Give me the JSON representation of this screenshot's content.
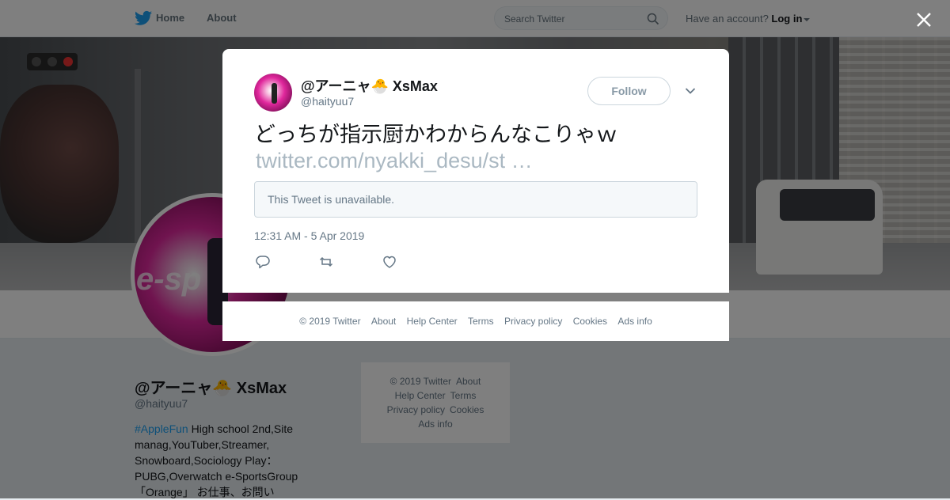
{
  "nav": {
    "home": "Home",
    "about": "About",
    "search_placeholder": "Search Twitter",
    "have_account": "Have an account?",
    "login": "Log in"
  },
  "profile": {
    "name": "@アーニャ🐣 XsMax",
    "handle": "@haityuu7",
    "bio_tag": "#AppleFun",
    "bio_text": " High school 2nd,Site manag,YouTuber,Streamer, Snowboard,Sociology Play：PUBG,Overwatch e-SportsGroup「Orange」 お仕事、お問い",
    "avatar_text": "e-sp"
  },
  "sidebar_footer": {
    "copyright": "© 2019 Twitter",
    "about": "About",
    "help": "Help Center",
    "terms": "Terms",
    "privacy": "Privacy policy",
    "cookies": "Cookies",
    "ads": "Ads info"
  },
  "tweet": {
    "author_name": "@アーニャ🐣 XsMax",
    "author_handle": "@haityuu7",
    "follow_label": "Follow",
    "text": "どっちが指示厨かわからんなこりゃｗ",
    "link": "twitter.com/nyakki_desu/st …",
    "quote_unavailable": "This Tweet is unavailable.",
    "timestamp": "12:31 AM - 5 Apr 2019"
  },
  "modal_footer": {
    "copyright": "© 2019 Twitter",
    "about": "About",
    "help": "Help Center",
    "terms": "Terms",
    "privacy": "Privacy policy",
    "cookies": "Cookies",
    "ads": "Ads info"
  },
  "icons": {
    "logo": "twitter-bird-icon",
    "search": "search-icon",
    "close": "close-icon",
    "chevron": "chevron-down-icon",
    "reply": "reply-icon",
    "retweet": "retweet-icon",
    "like": "heart-icon"
  },
  "colors": {
    "brand": "#1da1f2",
    "text_primary": "#14171a",
    "text_secondary": "#657786",
    "overlay": "rgba(0,0,0,0.5)"
  }
}
